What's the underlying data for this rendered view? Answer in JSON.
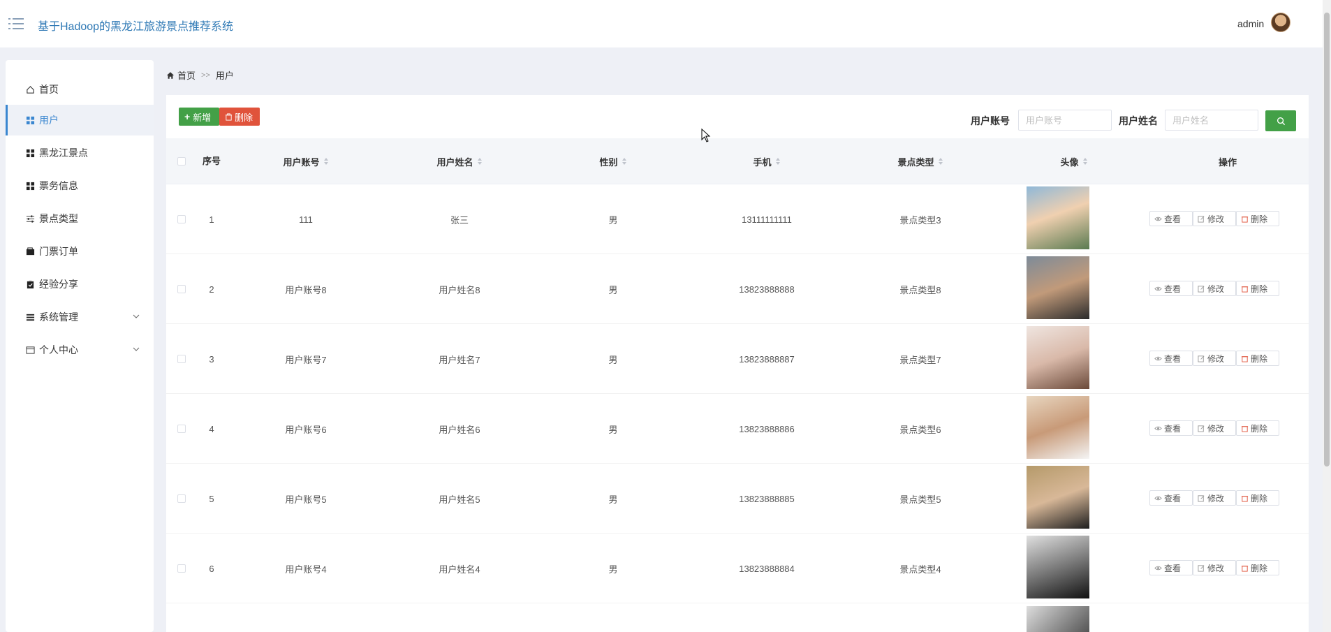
{
  "header": {
    "title": "基于Hadoop的黑龙江旅游景点推荐系统",
    "user": "admin"
  },
  "sidebar": {
    "items": [
      {
        "label": "首页",
        "icon": "home-icon"
      },
      {
        "label": "用户",
        "icon": "grid-icon",
        "active": true
      },
      {
        "label": "黑龙江景点",
        "icon": "grid-icon"
      },
      {
        "label": "票务信息",
        "icon": "grid-icon"
      },
      {
        "label": "景点类型",
        "icon": "sliders-icon"
      },
      {
        "label": "门票订单",
        "icon": "wallet-icon"
      },
      {
        "label": "经验分享",
        "icon": "clipboard-icon"
      },
      {
        "label": "系统管理",
        "icon": "list-icon",
        "expandable": true
      },
      {
        "label": "个人中心",
        "icon": "card-icon",
        "expandable": true
      }
    ]
  },
  "breadcrumb": {
    "home": "首页",
    "separator": ">>",
    "current": "用户"
  },
  "toolbar": {
    "add_label": "新增",
    "delete_label": "删除",
    "filter_account_label": "用户账号",
    "filter_account_placeholder": "用户账号",
    "filter_name_label": "用户姓名",
    "filter_name_placeholder": "用户姓名"
  },
  "table": {
    "headers": {
      "index": "序号",
      "account": "用户账号",
      "name": "用户姓名",
      "gender": "性别",
      "phone": "手机",
      "type": "景点类型",
      "avatar": "头像",
      "actions": "操作"
    },
    "actions": {
      "view": "查看",
      "edit": "修改",
      "delete": "删除"
    },
    "rows": [
      {
        "index": "1",
        "account": "111",
        "name": "张三",
        "gender": "男",
        "phone": "13111111111",
        "type": "景点类型3"
      },
      {
        "index": "2",
        "account": "用户账号8",
        "name": "用户姓名8",
        "gender": "男",
        "phone": "13823888888",
        "type": "景点类型8"
      },
      {
        "index": "3",
        "account": "用户账号7",
        "name": "用户姓名7",
        "gender": "男",
        "phone": "13823888887",
        "type": "景点类型7"
      },
      {
        "index": "4",
        "account": "用户账号6",
        "name": "用户姓名6",
        "gender": "男",
        "phone": "13823888886",
        "type": "景点类型6"
      },
      {
        "index": "5",
        "account": "用户账号5",
        "name": "用户姓名5",
        "gender": "男",
        "phone": "13823888885",
        "type": "景点类型5"
      },
      {
        "index": "6",
        "account": "用户账号4",
        "name": "用户姓名4",
        "gender": "男",
        "phone": "13823888884",
        "type": "景点类型4"
      }
    ]
  },
  "colors": {
    "accent": "#3a86d0",
    "success": "#43a047",
    "danger": "#e0533b"
  }
}
